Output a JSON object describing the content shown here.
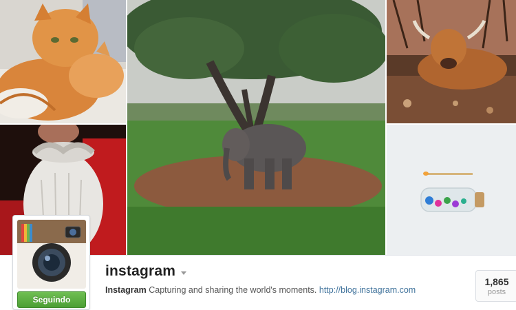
{
  "profile": {
    "username": "instagram",
    "follow_button": "Seguindo",
    "bio": {
      "name": "Instagram",
      "text": " Capturing and sharing the world's moments. ",
      "link": "http://blog.instagram.com"
    },
    "stats": [
      {
        "value": "1,865",
        "label": "posts"
      }
    ]
  },
  "photos": [
    {
      "subject": "cats"
    },
    {
      "subject": "beard"
    },
    {
      "subject": "elephant"
    },
    {
      "subject": "highland-cow"
    },
    {
      "subject": "bottle-and-match"
    }
  ],
  "colors": {
    "follow_green": "#5cae40",
    "link_blue": "#3f729b",
    "username": "#222222"
  }
}
